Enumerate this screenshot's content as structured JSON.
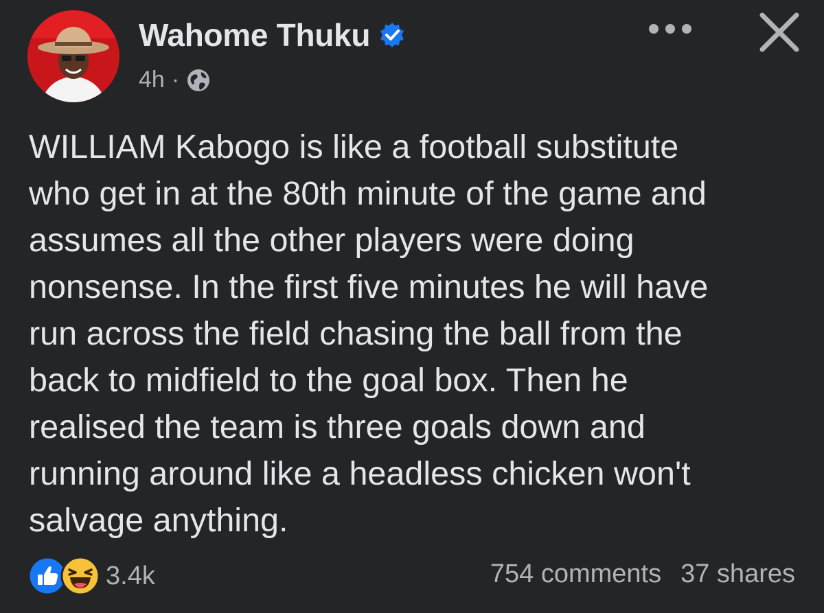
{
  "post": {
    "author": "Wahome Thuku",
    "verified": true,
    "time": "4h",
    "separator": "·",
    "audience_icon": "globe-icon",
    "body": "WILLIAM Kabogo is like a football substitute\nwho get in at the 80th minute of the game and\nassumes all the other players were doing\nnonsense. In the first five minutes he will have\nrun across the field chasing the ball from the\nback to midfield to the goal box. Then he\nrealised the team is three goals down and\nrunning around like a headless chicken won't\nsalvage anything."
  },
  "reactions": {
    "icons": [
      "like-icon",
      "haha-icon"
    ],
    "count": "3.4k"
  },
  "stats": {
    "comments": "754 comments",
    "shares": "37 shares"
  },
  "colors": {
    "background": "#242526",
    "text_primary": "#e4e6eb",
    "text_secondary": "#b0b3b8",
    "verified_blue": "#1877f2"
  }
}
